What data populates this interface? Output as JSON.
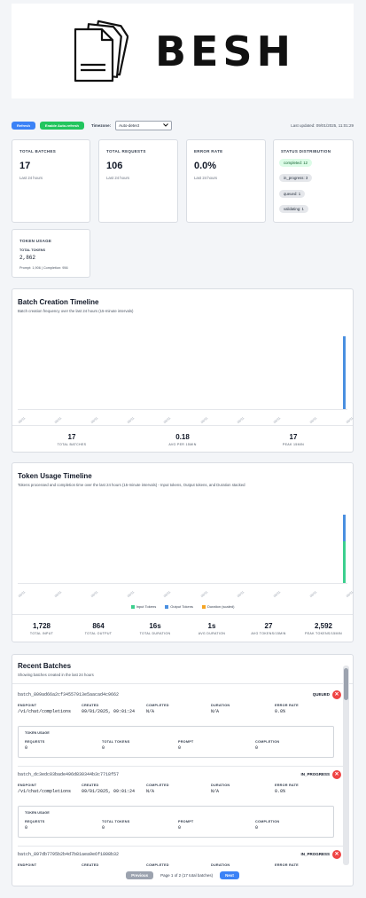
{
  "brand": {
    "name": "BESH"
  },
  "controls": {
    "refresh": "Refresh",
    "auto_refresh": "Enable Auto-refresh",
    "timezone_label": "Timezone:",
    "timezone_value": "Auto-detect",
    "last_updated": "Last updated: 09/01/2025, 11:01:29"
  },
  "stats": {
    "total_batches": {
      "title": "TOTAL BATCHES",
      "value": "17",
      "sub": "Last 24 hours"
    },
    "total_requests": {
      "title": "TOTAL REQUESTS",
      "value": "106",
      "sub": "Last 24 hours"
    },
    "error_rate": {
      "title": "ERROR RATE",
      "value": "0.0%",
      "sub": "Last 24 hours"
    },
    "status_distribution": {
      "title": "STATUS DISTRIBUTION",
      "items": [
        "completed: 12",
        "in_progress: 3",
        "queued: 1",
        "validating: 1"
      ]
    },
    "token_usage": {
      "title": "TOKEN USAGE",
      "label": "TOTAL TOKENS",
      "value": "2,862",
      "sub": "Prompt: 1,906 | Completion: 956"
    }
  },
  "batch_timeline": {
    "title": "Batch Creation Timeline",
    "subtitle": "Batch creation frequency over the last 24 hours (15-minute intervals)",
    "ticks": [
      "08/31",
      "08/31",
      "08/31",
      "08/31",
      "08/31",
      "08/31",
      "08/31",
      "08/31",
      "08/31",
      "08/31"
    ],
    "summary": [
      {
        "value": "17",
        "label": "TOTAL BATCHES"
      },
      {
        "value": "0.18",
        "label": "AVG PER 15MIN"
      },
      {
        "value": "17",
        "label": "PEAK 15MIN"
      }
    ],
    "color": "#4a8fe0"
  },
  "token_timeline": {
    "title": "Token Usage Timeline",
    "subtitle": "Tokens processed and completion time over the last 24 hours (15-minute intervals) - Input tokens, Output tokens, and Duration stacked",
    "ticks": [
      "08/31",
      "08/31",
      "08/31",
      "08/31",
      "08/31",
      "08/31",
      "08/31",
      "08/31",
      "08/31",
      "08/31"
    ],
    "legend": [
      {
        "label": "Input Tokens",
        "color": "#3ccf8e"
      },
      {
        "label": "Output Tokens",
        "color": "#4a8fe0"
      },
      {
        "label": "Duration (scaled)",
        "color": "#f5a524"
      }
    ],
    "summary": [
      {
        "value": "1,728",
        "label": "TOTAL INPUT"
      },
      {
        "value": "864",
        "label": "TOTAL OUTPUT"
      },
      {
        "value": "16s",
        "label": "TOTAL DURATION"
      },
      {
        "value": "1s",
        "label": "AVG DURATION"
      },
      {
        "value": "27",
        "label": "AVG TOKENS/15MIN"
      },
      {
        "value": "2,592",
        "label": "PEAK TOKENS/15MIN"
      }
    ]
  },
  "chart_data": [
    {
      "type": "bar",
      "title": "Batch Creation Timeline",
      "categories": [
        "08/31 interval (last)"
      ],
      "values": [
        17
      ],
      "xlabel": "",
      "ylabel": "",
      "grid": false
    },
    {
      "type": "bar",
      "title": "Token Usage Timeline",
      "categories": [
        "08/31 interval (last)"
      ],
      "series": [
        {
          "name": "Input Tokens",
          "values": [
            1728
          ]
        },
        {
          "name": "Output Tokens",
          "values": [
            864
          ]
        },
        {
          "name": "Duration (scaled)",
          "values": [
            0
          ]
        }
      ],
      "grid": false
    }
  ],
  "recent": {
    "title": "Recent Batches",
    "subtitle": "Showing batches created in the last 24 hours",
    "labels": {
      "endpoint": "ENDPOINT",
      "created": "CREATED",
      "completed": "COMPLETED",
      "duration": "DURATION",
      "error_rate": "ERROR RATE",
      "token_usage": "TOKEN USAGE",
      "requests": "REQUESTS",
      "total_tokens": "TOTAL TOKENS",
      "prompt": "PROMPT",
      "completion": "COMPLETION"
    },
    "batches": [
      {
        "id": "batch_809ad66a2cf34557913e5aacad4c9662",
        "status": "QUEUED",
        "endpoint": "/v1/chat/completions",
        "created": "09/01/2025, 09:01:24",
        "completed": "N/A",
        "duration": "N/A",
        "error_rate": "0.0%",
        "requests": "0",
        "total_tokens": "0",
        "prompt": "0",
        "completion": "0"
      },
      {
        "id": "batch_dc3edc03bade496d830344b3c7718f57",
        "status": "IN_PROGRESS",
        "endpoint": "/v1/chat/completions",
        "created": "09/01/2025, 09:01:24",
        "completed": "N/A",
        "duration": "N/A",
        "error_rate": "0.0%",
        "requests": "0",
        "total_tokens": "0",
        "prompt": "0",
        "completion": "0"
      },
      {
        "id": "batch_897db7795b2b4d7b81aea9e6f1808b32",
        "status": "IN_PROGRESS",
        "endpoint": "",
        "created": "",
        "completed": "",
        "duration": "",
        "error_rate": ""
      }
    ]
  },
  "pagination": {
    "previous": "Previous",
    "info": "Page 1 of 2 (17 total batches)",
    "next": "Next"
  }
}
